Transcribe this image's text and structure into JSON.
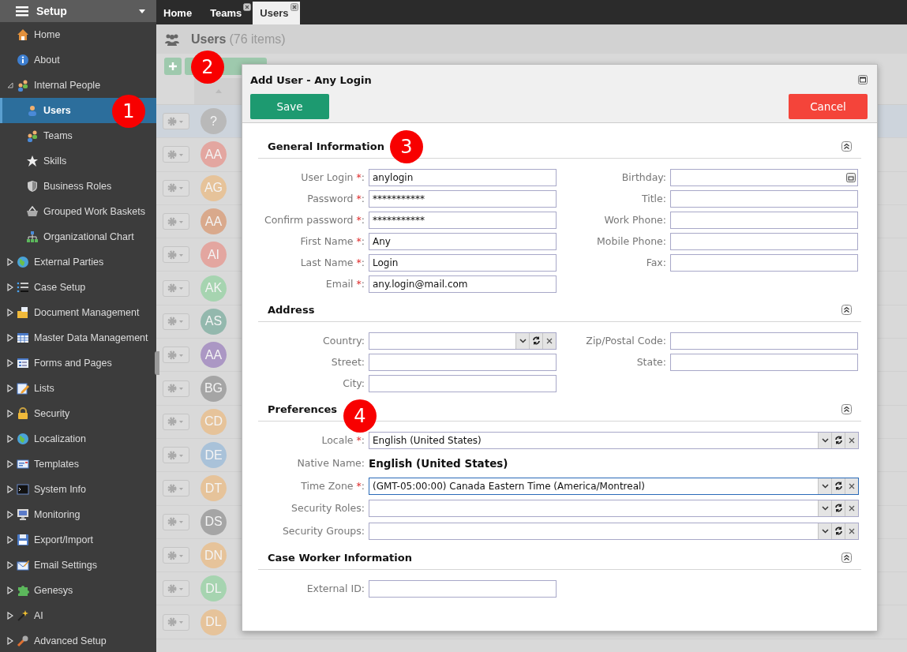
{
  "sidebar": {
    "title": "Setup",
    "items": [
      {
        "label": "Home",
        "selected": false
      },
      {
        "label": "About",
        "selected": false
      },
      {
        "label": "Internal People",
        "selected": false,
        "expanded": true,
        "children": [
          {
            "label": "Users",
            "selected": true
          },
          {
            "label": "Teams",
            "selected": false
          },
          {
            "label": "Skills",
            "selected": false
          },
          {
            "label": "Business Roles",
            "selected": false
          },
          {
            "label": "Grouped Work Baskets",
            "selected": false
          },
          {
            "label": "Organizational Chart",
            "selected": false
          }
        ]
      },
      {
        "label": "External Parties",
        "selected": false,
        "expanded": false
      },
      {
        "label": "Case Setup",
        "selected": false,
        "expanded": false
      },
      {
        "label": "Document Management",
        "selected": false,
        "expanded": false
      },
      {
        "label": "Master Data Management",
        "selected": false,
        "expanded": false
      },
      {
        "label": "Forms and Pages",
        "selected": false,
        "expanded": false
      },
      {
        "label": "Lists",
        "selected": false,
        "expanded": false
      },
      {
        "label": "Security",
        "selected": false,
        "expanded": false
      },
      {
        "label": "Localization",
        "selected": false,
        "expanded": false
      },
      {
        "label": "Templates",
        "selected": false,
        "expanded": false
      },
      {
        "label": "System Info",
        "selected": false,
        "expanded": false
      },
      {
        "label": "Monitoring",
        "selected": false,
        "expanded": false
      },
      {
        "label": "Export/Import",
        "selected": false,
        "expanded": false
      },
      {
        "label": "Email Settings",
        "selected": false,
        "expanded": false
      },
      {
        "label": "Genesys",
        "selected": false,
        "expanded": false
      },
      {
        "label": "AI",
        "selected": false,
        "expanded": false
      },
      {
        "label": "Advanced Setup",
        "selected": false,
        "expanded": false
      }
    ]
  },
  "tabs": [
    {
      "label": "Home",
      "selected": false,
      "closable": false
    },
    {
      "label": "Teams",
      "selected": false,
      "closable": true
    },
    {
      "label": "Users",
      "selected": true,
      "closable": true
    }
  ],
  "page": {
    "title": "Users",
    "count": "(76 items)"
  },
  "rows": [
    {
      "initials": "?",
      "color": "#b9b9b9",
      "selected": true
    },
    {
      "initials": "AA",
      "color": "#e3a6a0",
      "selected": false
    },
    {
      "initials": "AG",
      "color": "#e6c39a",
      "selected": false
    },
    {
      "initials": "AA",
      "color": "#d9a98c",
      "selected": false
    },
    {
      "initials": "AI",
      "color": "#e3a6a0",
      "selected": false
    },
    {
      "initials": "AK",
      "color": "#a6d4b0",
      "selected": false
    },
    {
      "initials": "AS",
      "color": "#93b8ad",
      "selected": false
    },
    {
      "initials": "AA",
      "color": "#ab97c4",
      "selected": false
    },
    {
      "initials": "BG",
      "color": "#a5a5a5",
      "selected": false
    },
    {
      "initials": "CD",
      "color": "#e6c39a",
      "selected": false
    },
    {
      "initials": "DE",
      "color": "#a9c2d9",
      "selected": false
    },
    {
      "initials": "DT",
      "color": "#e6c39a",
      "selected": false
    },
    {
      "initials": "DS",
      "color": "#a5a5a5",
      "selected": false
    },
    {
      "initials": "DN",
      "color": "#e6c39a",
      "selected": false
    },
    {
      "initials": "DL",
      "color": "#a6d4b0",
      "selected": false
    },
    {
      "initials": "DL",
      "color": "#e6c39a",
      "selected": false
    }
  ],
  "dialog": {
    "title": "Add User - Any Login",
    "save": "Save",
    "cancel": "Cancel",
    "sections": [
      {
        "title": "General Information",
        "columns": [
          [
            {
              "kind": "text",
              "label": "User Login",
              "required_mark": "*",
              "label_end": ":",
              "value": "anylogin"
            },
            {
              "kind": "text",
              "label": "Password",
              "required_mark": "*",
              "label_end": ":",
              "value": "***********"
            },
            {
              "kind": "text",
              "label": "Confirm password",
              "required_mark": "*",
              "label_end": ":",
              "value": "***********"
            },
            {
              "kind": "text",
              "label": "First Name",
              "required_mark": "*",
              "label_end": ":",
              "value": "Any"
            },
            {
              "kind": "text",
              "label": "Last Name",
              "required_mark": "*",
              "label_end": ":",
              "value": "Login"
            },
            {
              "kind": "text",
              "label": "Email",
              "required_mark": "*",
              "label_end": ":",
              "value": "any.login@mail.com"
            }
          ],
          [
            {
              "kind": "date",
              "label": "Birthday",
              "label_end": ":"
            },
            {
              "kind": "text",
              "label": "Title",
              "label_end": ":"
            },
            {
              "kind": "text",
              "label": "Work Phone",
              "label_end": ":"
            },
            {
              "kind": "text",
              "label": "Mobile Phone",
              "label_end": ":"
            },
            {
              "kind": "text",
              "label": "Fax",
              "label_end": ":"
            }
          ]
        ]
      },
      {
        "title": "Address",
        "columns": [
          [
            {
              "kind": "select",
              "label": "Country",
              "label_end": ":"
            },
            {
              "kind": "text",
              "label": "Street",
              "label_end": ":"
            },
            {
              "kind": "text",
              "label": "City",
              "label_end": ":"
            }
          ],
          [
            {
              "kind": "text",
              "label": "Zip/Postal Code",
              "label_end": ":"
            },
            {
              "kind": "text",
              "label": "State",
              "label_end": ":"
            }
          ]
        ]
      },
      {
        "title": "Preferences",
        "fields": [
          {
            "kind": "select",
            "label": "Locale",
            "required_mark": "*",
            "label_end": ":",
            "value": "English (United States)",
            "focused": false
          },
          {
            "kind": "display",
            "label": "Native Name",
            "label_end": ":",
            "value": "English (United States)"
          },
          {
            "kind": "select",
            "label": "Time Zone",
            "required_mark": "*",
            "label_end": ":",
            "value": "(GMT-05:00:00) Canada Eastern Time (America/Montreal)",
            "focused": true
          },
          {
            "kind": "select",
            "label": "Security Roles",
            "label_end": ":",
            "focused": false
          },
          {
            "kind": "select",
            "label": "Security Groups",
            "label_end": ":",
            "focused": false
          }
        ]
      },
      {
        "title": "Case Worker Information",
        "columns": [
          [
            {
              "kind": "text",
              "label": "External ID",
              "label_end": ":"
            }
          ]
        ]
      }
    ]
  },
  "annotations": [
    "1",
    "2",
    "3",
    "4"
  ]
}
